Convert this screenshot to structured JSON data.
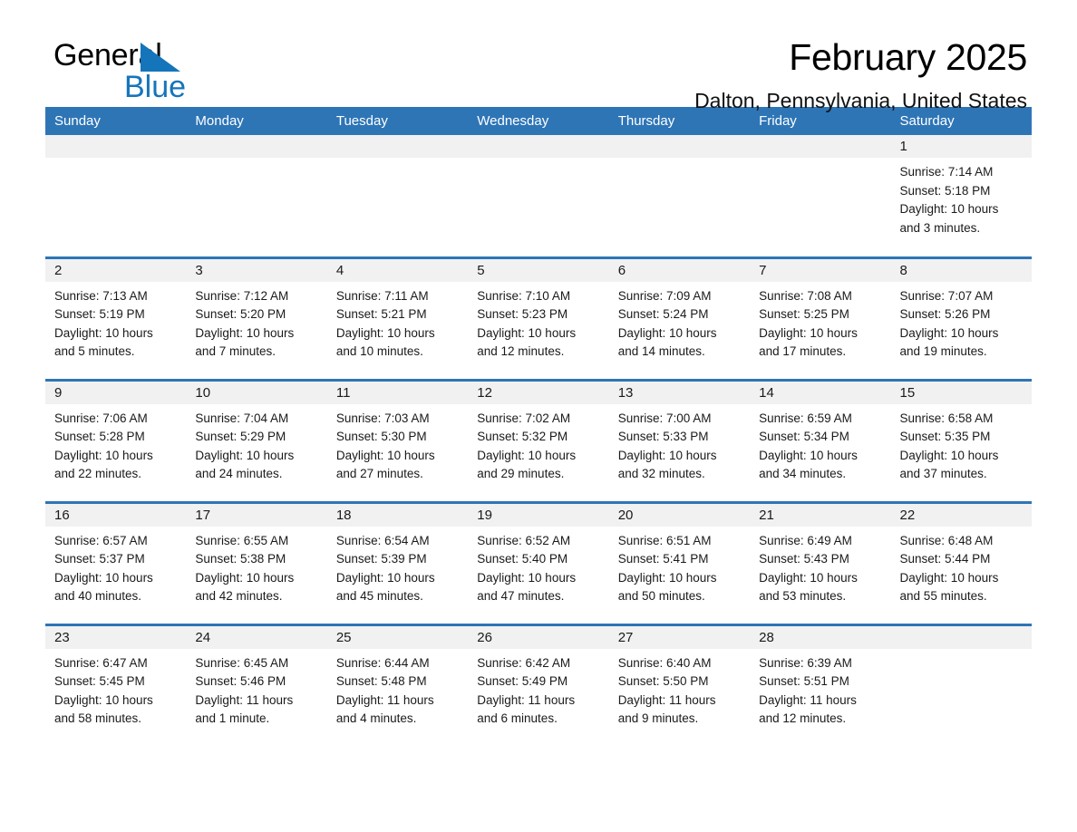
{
  "brand": {
    "word1": "General",
    "word2": "Blue",
    "triangle_color": "#1475bb"
  },
  "header": {
    "title": "February 2025",
    "location": "Dalton, Pennsylvania, United States"
  },
  "theme": {
    "header_blue": "#2e75b6",
    "daynum_band": "#f1f1f1",
    "text": "#1a1a1a"
  },
  "weekday_headers": [
    "Sunday",
    "Monday",
    "Tuesday",
    "Wednesday",
    "Thursday",
    "Friday",
    "Saturday"
  ],
  "weeks": [
    [
      {
        "day": "",
        "sunrise": "",
        "sunset": "",
        "daylight1": "",
        "daylight2": ""
      },
      {
        "day": "",
        "sunrise": "",
        "sunset": "",
        "daylight1": "",
        "daylight2": ""
      },
      {
        "day": "",
        "sunrise": "",
        "sunset": "",
        "daylight1": "",
        "daylight2": ""
      },
      {
        "day": "",
        "sunrise": "",
        "sunset": "",
        "daylight1": "",
        "daylight2": ""
      },
      {
        "day": "",
        "sunrise": "",
        "sunset": "",
        "daylight1": "",
        "daylight2": ""
      },
      {
        "day": "",
        "sunrise": "",
        "sunset": "",
        "daylight1": "",
        "daylight2": ""
      },
      {
        "day": "1",
        "sunrise": "Sunrise: 7:14 AM",
        "sunset": "Sunset: 5:18 PM",
        "daylight1": "Daylight: 10 hours",
        "daylight2": "and 3 minutes."
      }
    ],
    [
      {
        "day": "2",
        "sunrise": "Sunrise: 7:13 AM",
        "sunset": "Sunset: 5:19 PM",
        "daylight1": "Daylight: 10 hours",
        "daylight2": "and 5 minutes."
      },
      {
        "day": "3",
        "sunrise": "Sunrise: 7:12 AM",
        "sunset": "Sunset: 5:20 PM",
        "daylight1": "Daylight: 10 hours",
        "daylight2": "and 7 minutes."
      },
      {
        "day": "4",
        "sunrise": "Sunrise: 7:11 AM",
        "sunset": "Sunset: 5:21 PM",
        "daylight1": "Daylight: 10 hours",
        "daylight2": "and 10 minutes."
      },
      {
        "day": "5",
        "sunrise": "Sunrise: 7:10 AM",
        "sunset": "Sunset: 5:23 PM",
        "daylight1": "Daylight: 10 hours",
        "daylight2": "and 12 minutes."
      },
      {
        "day": "6",
        "sunrise": "Sunrise: 7:09 AM",
        "sunset": "Sunset: 5:24 PM",
        "daylight1": "Daylight: 10 hours",
        "daylight2": "and 14 minutes."
      },
      {
        "day": "7",
        "sunrise": "Sunrise: 7:08 AM",
        "sunset": "Sunset: 5:25 PM",
        "daylight1": "Daylight: 10 hours",
        "daylight2": "and 17 minutes."
      },
      {
        "day": "8",
        "sunrise": "Sunrise: 7:07 AM",
        "sunset": "Sunset: 5:26 PM",
        "daylight1": "Daylight: 10 hours",
        "daylight2": "and 19 minutes."
      }
    ],
    [
      {
        "day": "9",
        "sunrise": "Sunrise: 7:06 AM",
        "sunset": "Sunset: 5:28 PM",
        "daylight1": "Daylight: 10 hours",
        "daylight2": "and 22 minutes."
      },
      {
        "day": "10",
        "sunrise": "Sunrise: 7:04 AM",
        "sunset": "Sunset: 5:29 PM",
        "daylight1": "Daylight: 10 hours",
        "daylight2": "and 24 minutes."
      },
      {
        "day": "11",
        "sunrise": "Sunrise: 7:03 AM",
        "sunset": "Sunset: 5:30 PM",
        "daylight1": "Daylight: 10 hours",
        "daylight2": "and 27 minutes."
      },
      {
        "day": "12",
        "sunrise": "Sunrise: 7:02 AM",
        "sunset": "Sunset: 5:32 PM",
        "daylight1": "Daylight: 10 hours",
        "daylight2": "and 29 minutes."
      },
      {
        "day": "13",
        "sunrise": "Sunrise: 7:00 AM",
        "sunset": "Sunset: 5:33 PM",
        "daylight1": "Daylight: 10 hours",
        "daylight2": "and 32 minutes."
      },
      {
        "day": "14",
        "sunrise": "Sunrise: 6:59 AM",
        "sunset": "Sunset: 5:34 PM",
        "daylight1": "Daylight: 10 hours",
        "daylight2": "and 34 minutes."
      },
      {
        "day": "15",
        "sunrise": "Sunrise: 6:58 AM",
        "sunset": "Sunset: 5:35 PM",
        "daylight1": "Daylight: 10 hours",
        "daylight2": "and 37 minutes."
      }
    ],
    [
      {
        "day": "16",
        "sunrise": "Sunrise: 6:57 AM",
        "sunset": "Sunset: 5:37 PM",
        "daylight1": "Daylight: 10 hours",
        "daylight2": "and 40 minutes."
      },
      {
        "day": "17",
        "sunrise": "Sunrise: 6:55 AM",
        "sunset": "Sunset: 5:38 PM",
        "daylight1": "Daylight: 10 hours",
        "daylight2": "and 42 minutes."
      },
      {
        "day": "18",
        "sunrise": "Sunrise: 6:54 AM",
        "sunset": "Sunset: 5:39 PM",
        "daylight1": "Daylight: 10 hours",
        "daylight2": "and 45 minutes."
      },
      {
        "day": "19",
        "sunrise": "Sunrise: 6:52 AM",
        "sunset": "Sunset: 5:40 PM",
        "daylight1": "Daylight: 10 hours",
        "daylight2": "and 47 minutes."
      },
      {
        "day": "20",
        "sunrise": "Sunrise: 6:51 AM",
        "sunset": "Sunset: 5:41 PM",
        "daylight1": "Daylight: 10 hours",
        "daylight2": "and 50 minutes."
      },
      {
        "day": "21",
        "sunrise": "Sunrise: 6:49 AM",
        "sunset": "Sunset: 5:43 PM",
        "daylight1": "Daylight: 10 hours",
        "daylight2": "and 53 minutes."
      },
      {
        "day": "22",
        "sunrise": "Sunrise: 6:48 AM",
        "sunset": "Sunset: 5:44 PM",
        "daylight1": "Daylight: 10 hours",
        "daylight2": "and 55 minutes."
      }
    ],
    [
      {
        "day": "23",
        "sunrise": "Sunrise: 6:47 AM",
        "sunset": "Sunset: 5:45 PM",
        "daylight1": "Daylight: 10 hours",
        "daylight2": "and 58 minutes."
      },
      {
        "day": "24",
        "sunrise": "Sunrise: 6:45 AM",
        "sunset": "Sunset: 5:46 PM",
        "daylight1": "Daylight: 11 hours",
        "daylight2": "and 1 minute."
      },
      {
        "day": "25",
        "sunrise": "Sunrise: 6:44 AM",
        "sunset": "Sunset: 5:48 PM",
        "daylight1": "Daylight: 11 hours",
        "daylight2": "and 4 minutes."
      },
      {
        "day": "26",
        "sunrise": "Sunrise: 6:42 AM",
        "sunset": "Sunset: 5:49 PM",
        "daylight1": "Daylight: 11 hours",
        "daylight2": "and 6 minutes."
      },
      {
        "day": "27",
        "sunrise": "Sunrise: 6:40 AM",
        "sunset": "Sunset: 5:50 PM",
        "daylight1": "Daylight: 11 hours",
        "daylight2": "and 9 minutes."
      },
      {
        "day": "28",
        "sunrise": "Sunrise: 6:39 AM",
        "sunset": "Sunset: 5:51 PM",
        "daylight1": "Daylight: 11 hours",
        "daylight2": "and 12 minutes."
      },
      {
        "day": "",
        "sunrise": "",
        "sunset": "",
        "daylight1": "",
        "daylight2": ""
      }
    ]
  ]
}
